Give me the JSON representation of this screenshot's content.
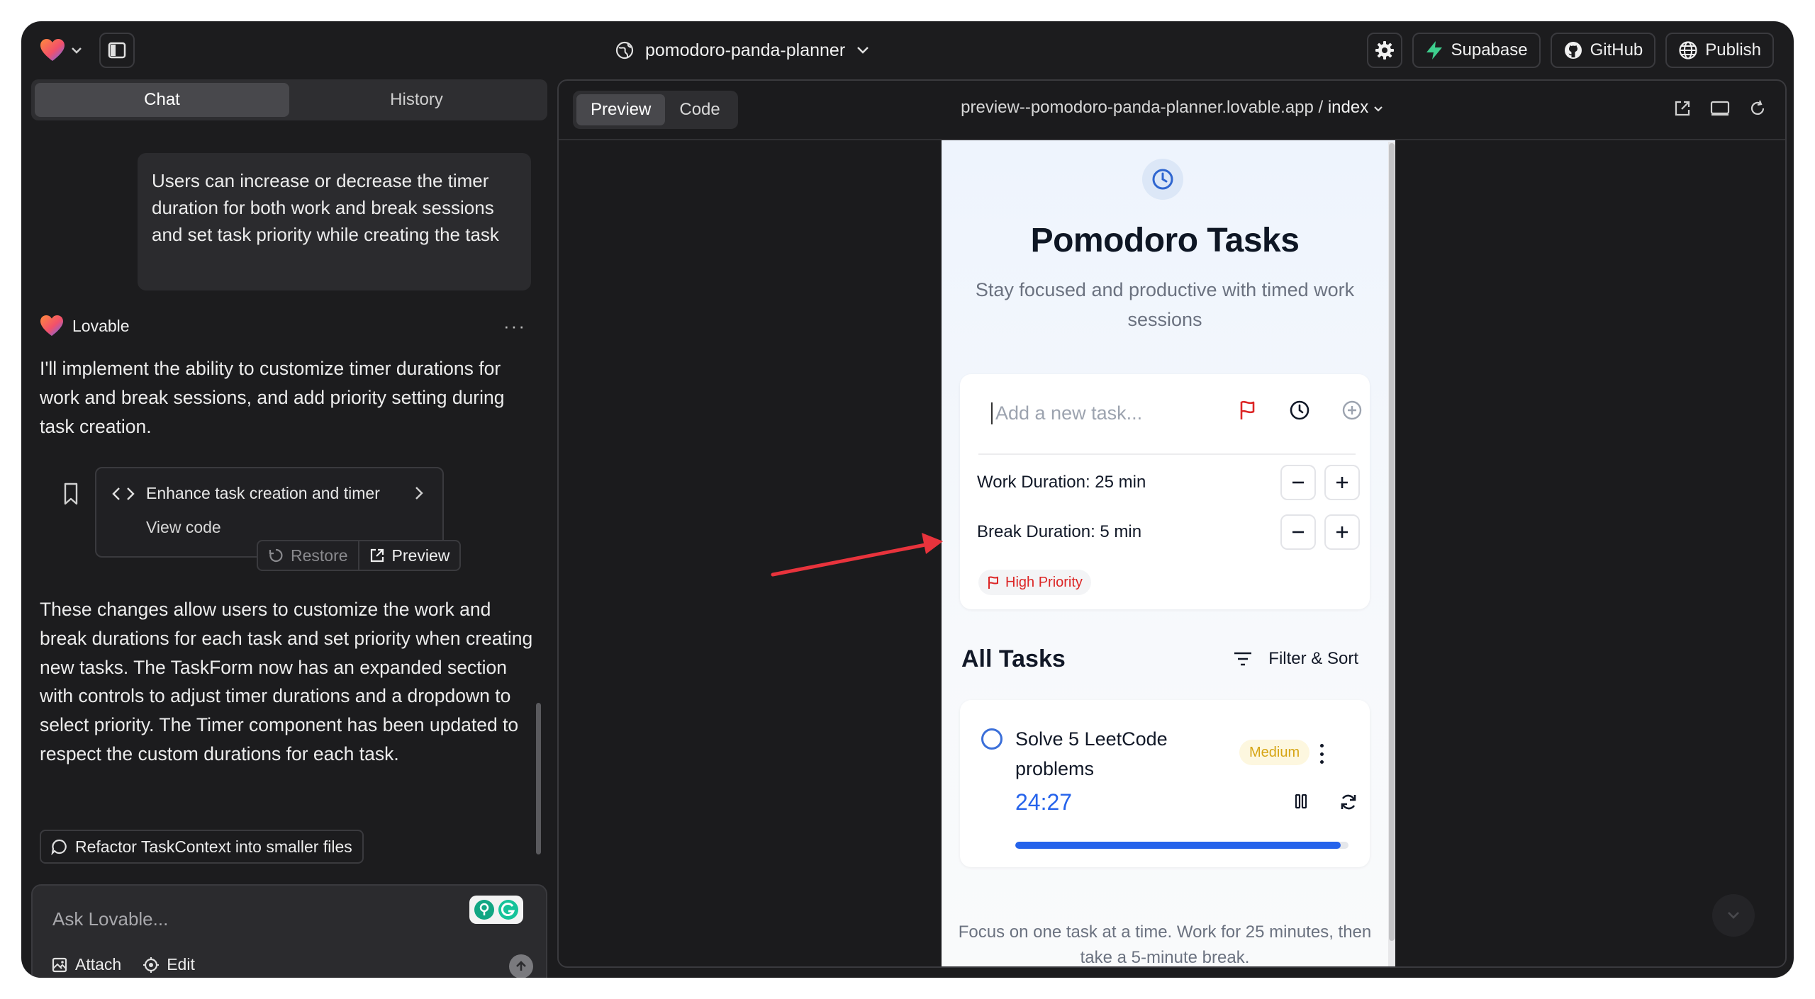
{
  "topbar": {
    "project_name": "pomodoro-panda-planner",
    "buttons": {
      "supabase": "Supabase",
      "github": "GitHub",
      "publish": "Publish"
    }
  },
  "left": {
    "tabs": [
      {
        "label": "Chat",
        "active": true
      },
      {
        "label": "History",
        "active": false
      }
    ],
    "user_message": "Users can increase or decrease the timer duration for both work and break sessions and set task priority while creating the task",
    "assistant_name": "Lovable",
    "assistant_para1": "I'll implement the ability to customize timer durations for work and break sessions, and add priority setting during task creation.",
    "code_card": {
      "title": "Enhance task creation and timer",
      "view_code": "View code"
    },
    "actions": {
      "restore": "Restore",
      "preview": "Preview"
    },
    "assistant_para2": "These changes allow users to customize the work and break durations for each task and set priority when creating new tasks. The TaskForm now has an expanded section with controls to adjust timer durations and a dropdown to select priority. The Timer component has been updated to respect the custom durations for each task.",
    "suggestion": "Refactor TaskContext into smaller files",
    "composer": {
      "placeholder": "Ask Lovable...",
      "attach": "Attach",
      "edit": "Edit"
    }
  },
  "right": {
    "tabs": [
      {
        "label": "Preview",
        "active": true
      },
      {
        "label": "Code",
        "active": false
      }
    ],
    "url_host": "preview--pomodoro-panda-planner.lovable.app",
    "url_sep": " / ",
    "url_page": "index",
    "app": {
      "title": "Pomodoro Tasks",
      "subtitle": "Stay focused and productive with timed work sessions",
      "task_placeholder": "Add a new task...",
      "work_duration": "Work Duration: 25 min",
      "break_duration": "Break Duration: 5 min",
      "priority": "High Priority",
      "all_tasks": "All Tasks",
      "filter_sort": "Filter & Sort",
      "task": {
        "title": "Solve 5 LeetCode problems",
        "badge": "Medium",
        "timer": "24:27",
        "progress": 0.977
      },
      "footer": "Focus on one task at a time. Work for 25 minutes, then take a 5-minute break."
    }
  },
  "colors": {
    "window_bg": "#1c1c1e",
    "accent_blue": "#2563eb",
    "priority_red": "#dc2626",
    "medium_amber": "#d6a515",
    "supabase_green": "#3ecf8e",
    "annotation_arrow": "#e8333c"
  },
  "icons": [
    "heart-logo-icon",
    "chevron-down-icon",
    "sidebar-icon",
    "globe-icon",
    "gear-icon",
    "bolt-icon",
    "github-icon",
    "bookmark-icon",
    "code-icon",
    "chevron-right-icon",
    "restore-icon",
    "external-link-icon",
    "chat-bubble-icon",
    "image-icon",
    "target-icon",
    "arrow-up-icon",
    "clock-icon",
    "flag-icon",
    "plus-circle-icon",
    "minus-icon",
    "plus-icon",
    "filter-icon",
    "kebab-icon",
    "pause-icon",
    "refresh-icon",
    "monitor-icon"
  ]
}
